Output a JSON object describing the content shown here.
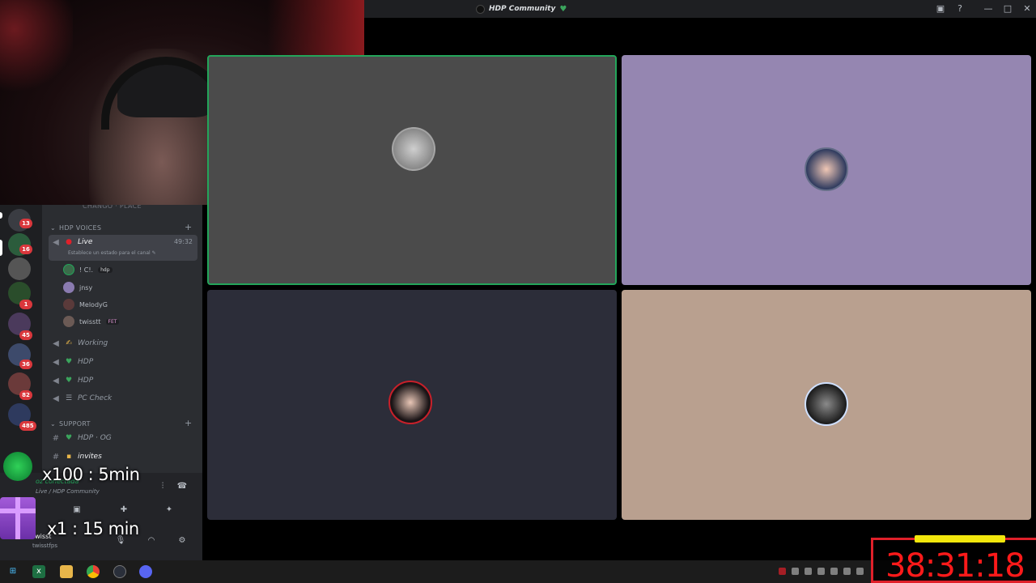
{
  "window": {
    "title": "HDP Community",
    "title_heart": "♥",
    "controls": [
      "▣",
      "?",
      "—",
      "□",
      "✕"
    ]
  },
  "rail": {
    "badges": [
      "13",
      "16",
      "1",
      "45",
      "36",
      "82",
      "485"
    ]
  },
  "channels": {
    "top_cut": "CHANGO · PLACE",
    "category_voices": "HDP VOICES",
    "active_channel": {
      "name": "Live",
      "time": "49:32",
      "status_hint": "Establece un estado para el canal ✎"
    },
    "voice_users": [
      {
        "name": "! C!.",
        "tag": "hdp"
      },
      {
        "name": "jnsy",
        "tag": ""
      },
      {
        "name": "MelodyG",
        "tag": ""
      },
      {
        "name": "twisstt",
        "tag": "FET"
      }
    ],
    "voice_channels": [
      "Working",
      "HDP",
      "HDP",
      "PC Check"
    ],
    "category_support": "SUPPORT",
    "support_channels": [
      "HDP · OG",
      "invites"
    ]
  },
  "panel": {
    "vc_status": "oz conectada",
    "vc_where": "Live / HDP Community",
    "username": "twisst",
    "handle": "twisstfps"
  },
  "overlays": {
    "reward_1": "x100 : 5min",
    "reward_2": "x1 : 15 min",
    "timer": "38:31:18"
  },
  "colors": {
    "tile_1": "#4b4b4b",
    "tile_2": "#9586b1",
    "tile_3": "#2c2d39",
    "tile_4": "#b9a08f",
    "speaking_border": "#23a55a",
    "timer_red": "#ff1a1a",
    "timer_bar": "#f2e60c"
  },
  "taskbar": {
    "apps": [
      "windows-start",
      "excel",
      "file-explorer",
      "chrome",
      "steam",
      "discord"
    ]
  }
}
